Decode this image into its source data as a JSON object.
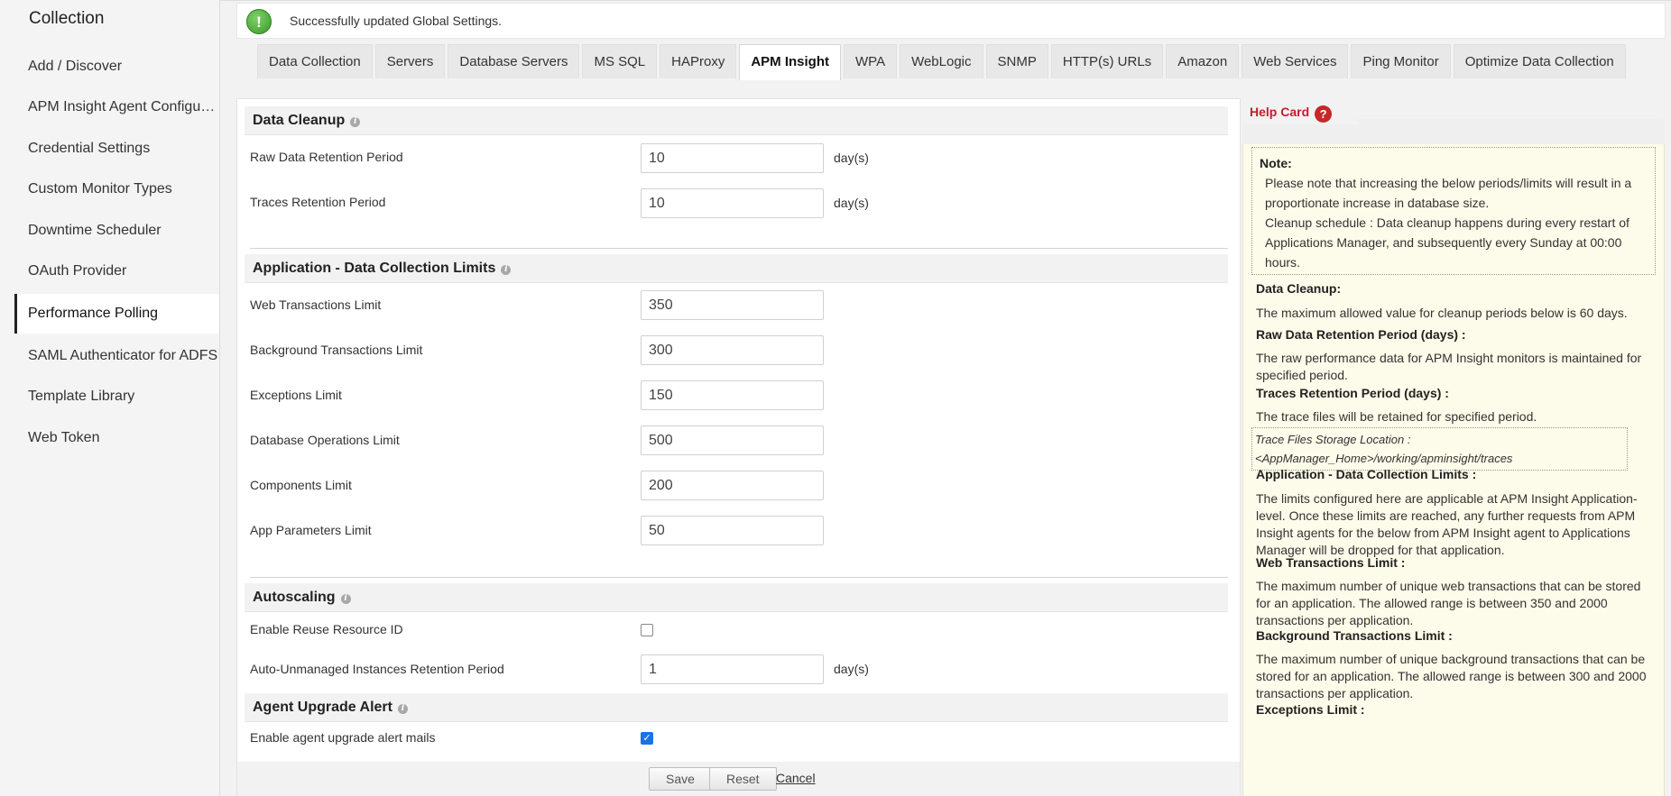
{
  "sidebar": {
    "title": "Collection",
    "items": [
      {
        "label": "Add / Discover"
      },
      {
        "label": "APM Insight Agent Configuration"
      },
      {
        "label": "Credential Settings"
      },
      {
        "label": "Custom Monitor Types"
      },
      {
        "label": "Downtime Scheduler"
      },
      {
        "label": "OAuth Provider"
      },
      {
        "label": "Performance Polling",
        "active": true
      },
      {
        "label": "SAML Authenticator for ADFS"
      },
      {
        "label": "Template Library"
      },
      {
        "label": "Web Token"
      }
    ]
  },
  "notification": {
    "icon": "success-exclamation-icon",
    "text": "Successfully updated Global Settings."
  },
  "tabs": [
    {
      "label": "Data Collection"
    },
    {
      "label": "Servers"
    },
    {
      "label": "Database Servers"
    },
    {
      "label": "MS SQL"
    },
    {
      "label": "HAProxy"
    },
    {
      "label": "APM Insight",
      "active": true
    },
    {
      "label": "WPA"
    },
    {
      "label": "WebLogic"
    },
    {
      "label": "SNMP"
    },
    {
      "label": "HTTP(s) URLs"
    },
    {
      "label": "Amazon"
    },
    {
      "label": "Web Services"
    },
    {
      "label": "Ping Monitor"
    },
    {
      "label": "Optimize Data Collection"
    }
  ],
  "form": {
    "data_cleanup": {
      "title": "Data Cleanup",
      "raw_label": "Raw Data Retention Period",
      "raw_value": "10",
      "raw_unit": "day(s)",
      "traces_label": "Traces Retention Period",
      "traces_value": "10",
      "traces_unit": "day(s)"
    },
    "limits": {
      "title": "Application - Data Collection Limits",
      "web_label": "Web Transactions Limit",
      "web_value": "350",
      "bg_label": "Background Transactions Limit",
      "bg_value": "300",
      "exc_label": "Exceptions Limit",
      "exc_value": "150",
      "db_label": "Database Operations Limit",
      "db_value": "500",
      "comp_label": "Components Limit",
      "comp_value": "200",
      "params_label": "App Parameters Limit",
      "params_value": "50"
    },
    "autoscaling": {
      "title": "Autoscaling",
      "reuse_label": "Enable Reuse Resource ID",
      "reuse_checked": false,
      "unmanaged_label": "Auto-Unmanaged Instances Retention Period",
      "unmanaged_value": "1",
      "unmanaged_unit": "day(s)"
    },
    "agent_upgrade": {
      "title": "Agent Upgrade Alert",
      "mail_label": "Enable agent upgrade alert mails",
      "mail_checked": true
    },
    "buttons": {
      "save": "Save",
      "reset": "Reset",
      "cancel": "Cancel"
    }
  },
  "help": {
    "title": "Help Card",
    "note_title": "Note:",
    "note_1": "Please note that increasing the below periods/limits will result in a proportionate increase in database size.",
    "note_2": "Cleanup schedule : Data cleanup happens during every restart of Applications Manager, and subsequently every Sunday at 00:00 hours.",
    "cleanup_h": "Data Cleanup:",
    "cleanup_p": "The maximum allowed value for cleanup periods below is 60 days.",
    "raw_h": "Raw Data Retention Period (days) :",
    "raw_p": "The raw performance data for APM Insight monitors is maintained for specified period.",
    "traces_h": "Traces Retention Period (days) :",
    "traces_p": "The trace files will be retained for specified period.",
    "storage_1": "Trace Files Storage Location :",
    "storage_2": "<AppManager_Home>/working/apminsight/traces",
    "limits_h": "Application - Data Collection Limits :",
    "limits_p": "The limits configured here are applicable at APM Insight Application-level. Once these limits are reached, any further requests from APM Insight agents for the below from APM Insight agent to Applications Manager will be dropped for that application.",
    "web_h": "Web Transactions Limit :",
    "web_p": "The maximum number of unique web transactions that can be stored for an application. The allowed range is between 350 and 2000 transactions per application.",
    "bg_h": "Background Transactions Limit :",
    "bg_p": "The maximum number of unique background transactions that can be stored for an application. The allowed range is between 300 and 2000 transactions per application.",
    "exc_h": "Exceptions Limit :"
  }
}
